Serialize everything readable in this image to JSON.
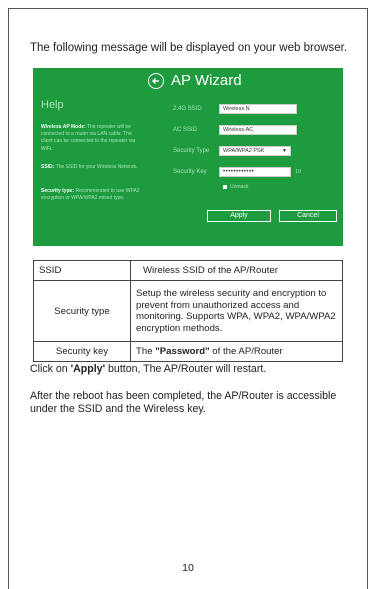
{
  "intro": "The following message will be displayed on your web browser.",
  "wizard": {
    "title": "AP Wizard",
    "help_title": "Help",
    "help_text": [
      {
        "bold": "Wireless AP Mode:",
        "rest": " The repeater will be connected to a router via LAN cable. The client can be connected to the repeater via WiFi."
      },
      {
        "bold": "SSID:",
        "rest": " The SSID for your Wireless Network."
      },
      {
        "bold": "Security type:",
        "rest": " Recommended to use WPA2 encryption or WPA/WPA2 mixed type."
      }
    ],
    "fields": {
      "ssid_24_label": "2.4G SSID",
      "ssid_24_value": "Wireless.N",
      "ssid_ac_label": "AC SSID",
      "ssid_ac_value": "Wireless.AC",
      "security_type_label": "Security Type",
      "security_type_value": "WPA/WPA2 PSK",
      "security_key_label": "Security Key",
      "security_key_value": "••••••••••••",
      "security_key_count": "10",
      "unmask_label": "Unmask"
    },
    "apply_label": "Apply",
    "cancel_label": "Cancel"
  },
  "table": [
    {
      "term": "SSID",
      "description": "Wireless SSID of the AP/Router"
    },
    {
      "term": "Security type",
      "description": "Setup the wireless security and encryption to prevent from unauthorized access and monitoring. Supports WPA, WPA2, WPA/WPA2 encryption methods."
    },
    {
      "term": "Security key",
      "description_prefix": "The ",
      "description_bold": "\"Password\"",
      "description_suffix": " of the AP/Router"
    }
  ],
  "para1": {
    "prefix": "Click on ",
    "bold": "'Apply'",
    "suffix": " button, The AP/Router will restart."
  },
  "para2": "After the reboot has been completed, the AP/Router is accessible under the SSID and the Wireless key.",
  "page_number": "10",
  "colors": {
    "wizard_bg": "#1e9a3f",
    "wizard_text": "#a7e3b8"
  }
}
